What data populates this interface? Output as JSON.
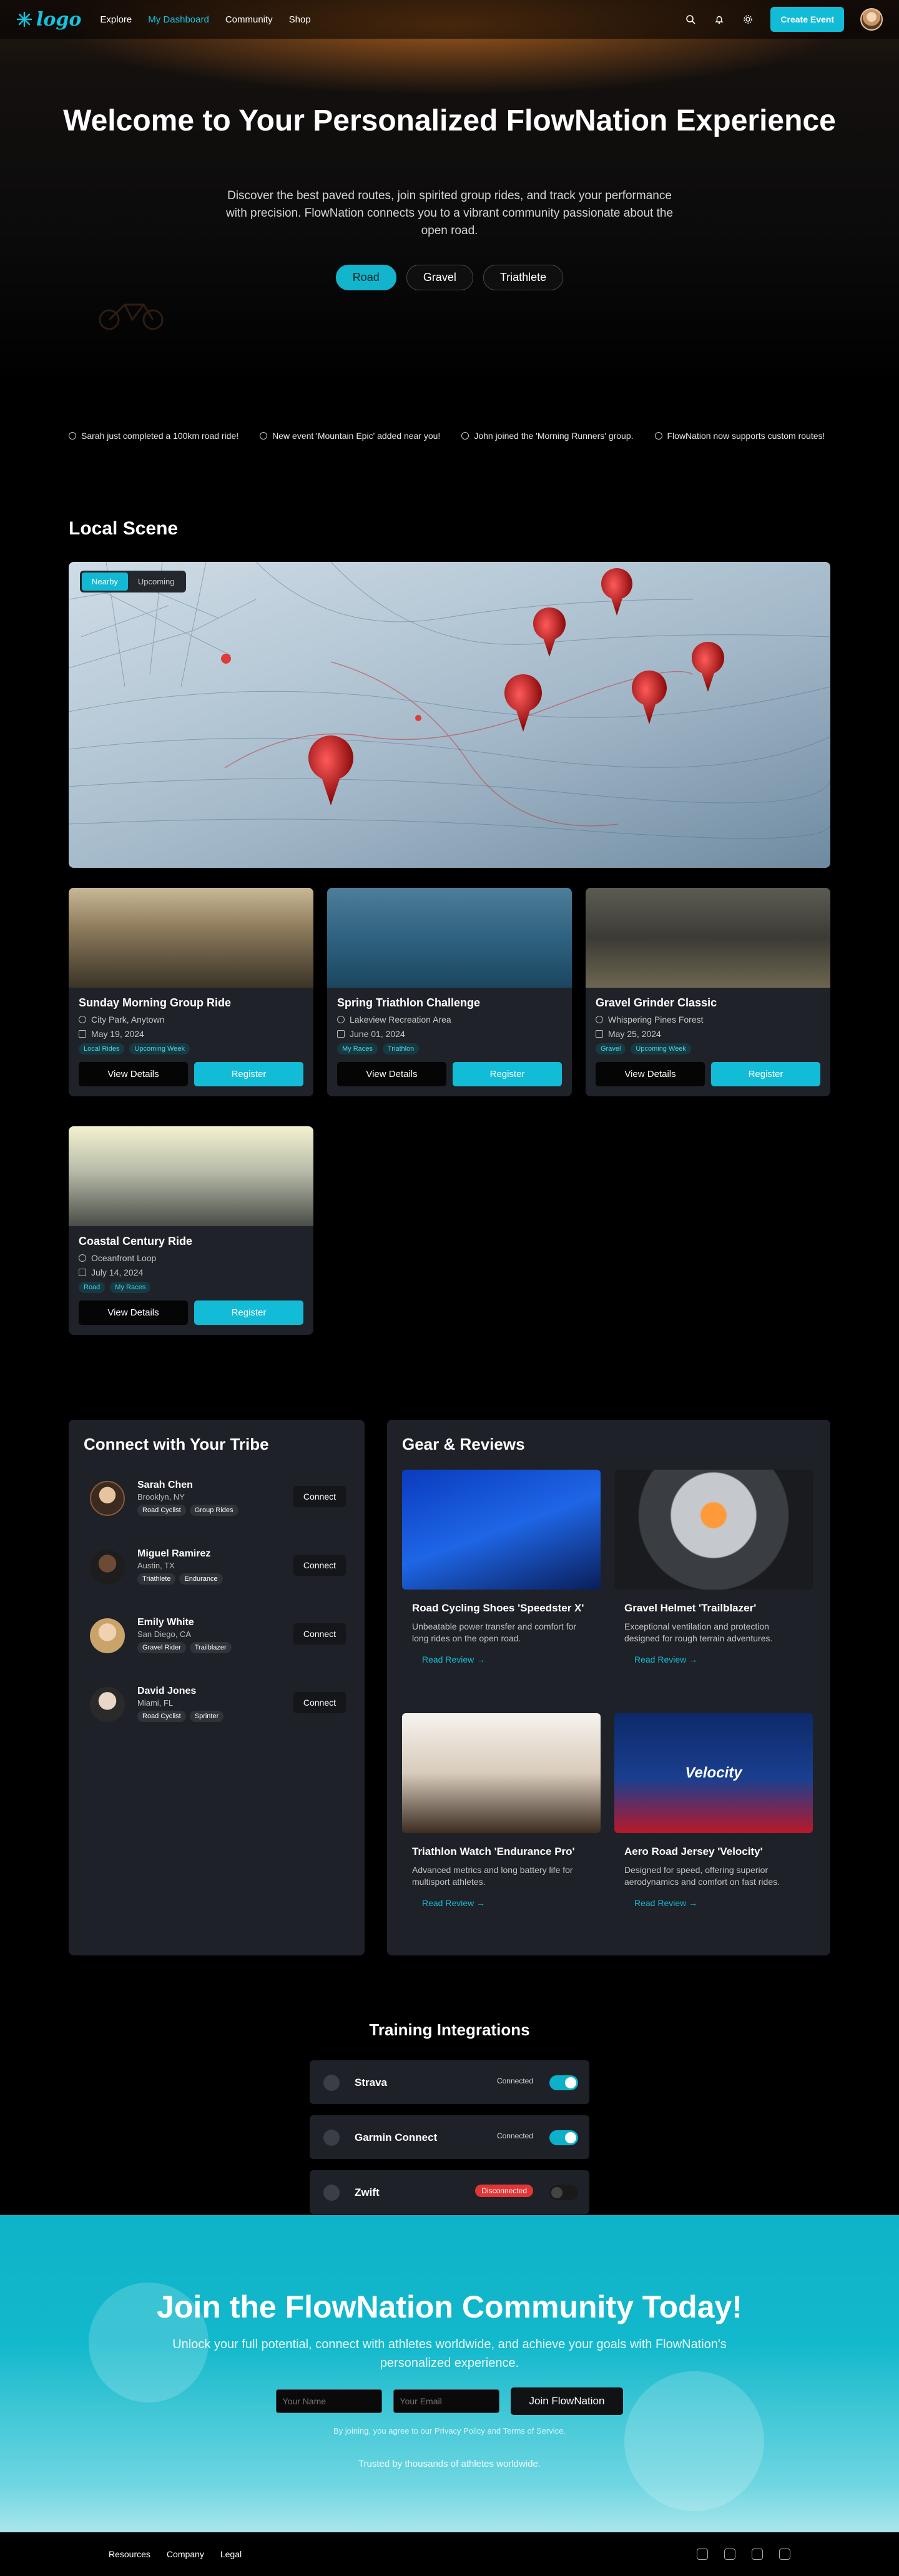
{
  "nav": {
    "logo": "logo",
    "links": [
      "Explore",
      "My Dashboard",
      "Community",
      "Shop"
    ],
    "create": "Create Event"
  },
  "hero": {
    "title": "Welcome to Your Personalized FlowNation Experience",
    "subtitle": "Discover the best paved routes, join spirited group rides, and track your performance with precision. FlowNation connects you to a vibrant community passionate about the open road.",
    "pills": [
      "Road",
      "Gravel",
      "Triathlete"
    ]
  },
  "ticker": [
    "Sarah just completed a 100km road ride!",
    "New event 'Mountain Epic' added near you!",
    "John joined the 'Morning Runners' group.",
    "FlowNation now supports custom routes!"
  ],
  "local": {
    "title": "Local Scene",
    "tabs": [
      "Nearby",
      "Upcoming"
    ],
    "events": [
      {
        "title": "Sunday Morning Group Ride",
        "location": "City Park, Anytown",
        "date": "May 19, 2024",
        "tags": [
          "Local Rides",
          "Upcoming Week"
        ]
      },
      {
        "title": "Spring Triathlon Challenge",
        "location": "Lakeview Recreation Area",
        "date": "June 01, 2024",
        "tags": [
          "My Races",
          "Triathlon"
        ]
      },
      {
        "title": "Gravel Grinder Classic",
        "location": "Whispering Pines Forest",
        "date": "May 25, 2024",
        "tags": [
          "Gravel",
          "Upcoming Week"
        ]
      },
      {
        "title": "Coastal Century Ride",
        "location": "Oceanfront Loop",
        "date": "July 14, 2024",
        "tags": [
          "Road",
          "My Races"
        ]
      }
    ],
    "view": "View Details",
    "register": "Register"
  },
  "tribe": {
    "title": "Connect with Your Tribe",
    "connect": "Connect",
    "people": [
      {
        "name": "Sarah Chen",
        "location": "Brooklyn, NY",
        "tags": [
          "Road Cyclist",
          "Group Rides"
        ]
      },
      {
        "name": "Miguel Ramirez",
        "location": "Austin, TX",
        "tags": [
          "Triathlete",
          "Endurance"
        ]
      },
      {
        "name": "Emily White",
        "location": "San Diego, CA",
        "tags": [
          "Gravel Rider",
          "Trailblazer"
        ]
      },
      {
        "name": "David Jones",
        "location": "Miami, FL",
        "tags": [
          "Road Cyclist",
          "Sprinter"
        ]
      }
    ]
  },
  "gear": {
    "title": "Gear & Reviews",
    "read": "Read Review",
    "items": [
      {
        "title": "Road Cycling Shoes 'Speedster X'",
        "desc": "Unbeatable power transfer and comfort for long rides on the open road."
      },
      {
        "title": "Gravel Helmet 'Trailblazer'",
        "desc": "Exceptional ventilation and protection designed for rough terrain adventures."
      },
      {
        "title": "Triathlon Watch 'Endurance Pro'",
        "desc": "Advanced metrics and long battery life for multisport athletes."
      },
      {
        "title": "Aero Road Jersey 'Velocity'",
        "desc": "Designed for speed, offering superior aerodynamics and comfort on fast rides.",
        "print": "Velocity"
      }
    ]
  },
  "integrations": {
    "title": "Training Integrations",
    "items": [
      {
        "name": "Strava",
        "status": "Connected"
      },
      {
        "name": "Garmin Connect",
        "status": "Connected"
      },
      {
        "name": "Zwift",
        "status": "Disconnected"
      }
    ]
  },
  "cta": {
    "title": "Join the FlowNation Community Today!",
    "lead": "Unlock your full potential, connect with athletes worldwide, and achieve your goals with FlowNation's personalized experience.",
    "name_ph": "Your Name",
    "email_ph": "Your Email",
    "join": "Join FlowNation",
    "small": "By joining, you agree to our Privacy Policy and Terms of Service.",
    "trust": "Trusted by thousands of athletes worldwide."
  },
  "footer": {
    "links": [
      "Resources",
      "Company",
      "Legal"
    ]
  },
  "colors": {
    "accent": "#13bcd6",
    "danger": "#e23636"
  }
}
